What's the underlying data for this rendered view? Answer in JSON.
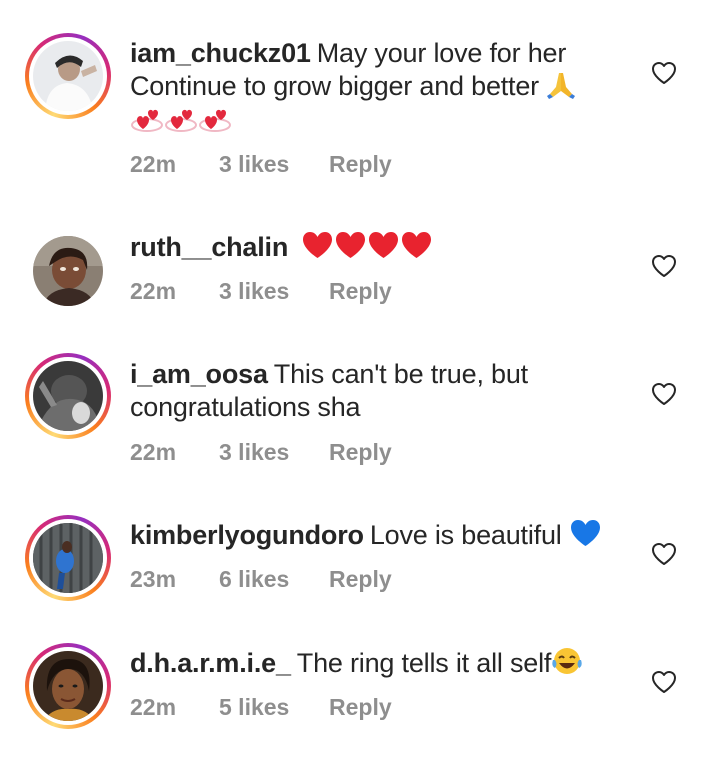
{
  "comments": [
    {
      "username": "iam_chuckz01",
      "text": "May your love for her Continue to grow bigger and better",
      "time": "22m",
      "likes": "3 likes",
      "reply": "Reply",
      "emoji": [
        "folded-hands",
        "revolving-hearts",
        "revolving-hearts",
        "revolving-hearts"
      ]
    },
    {
      "username": "ruth__chalin",
      "text": "",
      "time": "22m",
      "likes": "3 likes",
      "reply": "Reply",
      "emoji": [
        "red-heart",
        "red-heart",
        "red-heart",
        "red-heart"
      ]
    },
    {
      "username": "i_am_oosa",
      "text": "This can't be true, but congratulations sha",
      "time": "22m",
      "likes": "3 likes",
      "reply": "Reply",
      "emoji": []
    },
    {
      "username": "kimberlyogundoro",
      "text": "Love is beautiful",
      "time": "23m",
      "likes": "6 likes",
      "reply": "Reply",
      "emoji": [
        "blue-heart"
      ]
    },
    {
      "username": "d.h.a.r.m.i.e_",
      "text": "The ring tells it all self",
      "time": "22m",
      "likes": "5 likes",
      "reply": "Reply",
      "emoji": [
        "laughing-tears"
      ]
    }
  ],
  "colors": {
    "text": "#262626",
    "meta": "#8e8e8e",
    "heart_red": "#e8232f",
    "heart_blue": "#1877e6",
    "story_ring": [
      "#feda75",
      "#fa7e1e",
      "#d62976",
      "#962fbf"
    ]
  },
  "icons": {
    "like": "heart-outline-icon"
  }
}
